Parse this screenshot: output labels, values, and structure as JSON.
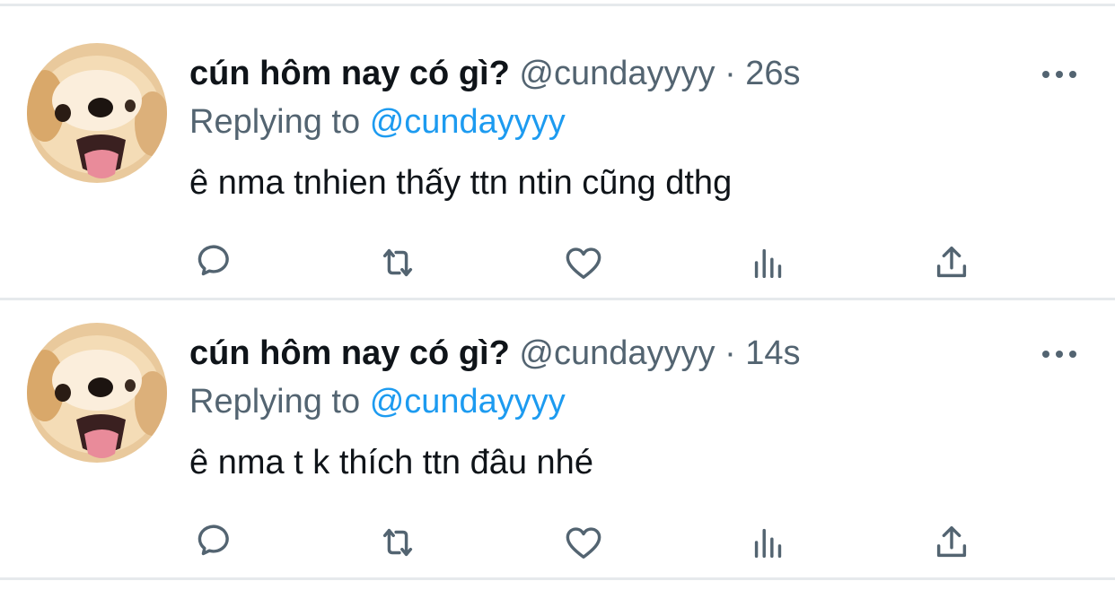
{
  "tweets": [
    {
      "display_name": "cún hôm nay có gì?",
      "handle": "@cundayyyy",
      "separator": "·",
      "time": "26s",
      "replying_prefix": "Replying to",
      "replying_to": "@cundayyyy",
      "text": "ê nma tnhien thấy ttn ntin cũng dthg",
      "avatar": "puppy-avatar",
      "icons": [
        "reply-icon",
        "retweet-icon",
        "like-icon",
        "views-icon",
        "share-icon",
        "more-icon"
      ]
    },
    {
      "display_name": "cún hôm nay có gì?",
      "handle": "@cundayyyy",
      "separator": "·",
      "time": "14s",
      "replying_prefix": "Replying to",
      "replying_to": "@cundayyyy",
      "text": "ê nma t k thích ttn đâu nhé",
      "avatar": "puppy-avatar",
      "icons": [
        "reply-icon",
        "retweet-icon",
        "like-icon",
        "views-icon",
        "share-icon",
        "more-icon"
      ]
    }
  ],
  "colors": {
    "name": "#0f1419",
    "meta": "#536471",
    "mention": "#1d9bf0",
    "divider": "#e6e9ec",
    "background": "#ffffff"
  }
}
